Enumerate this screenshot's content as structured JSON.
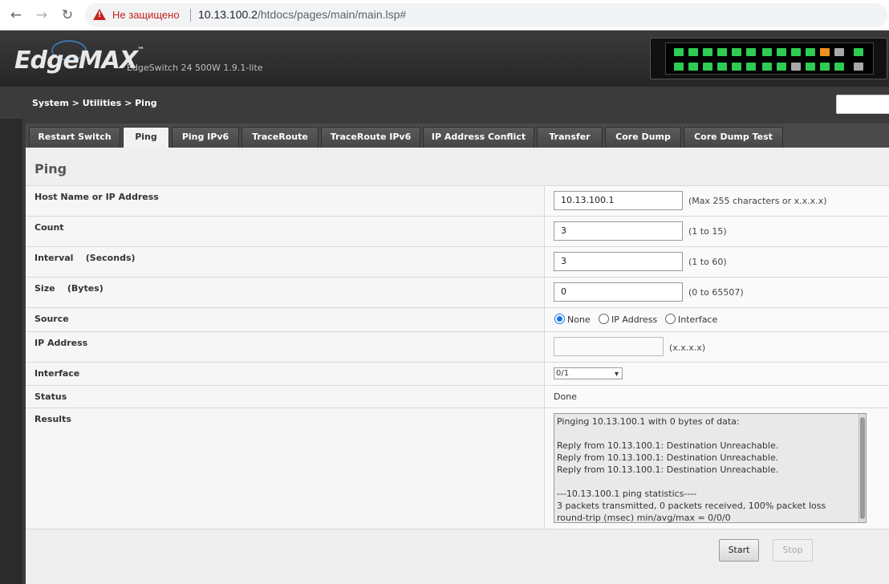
{
  "browser": {
    "insecure_label": "Не защищено",
    "url_host": "10.13.100.2",
    "url_path": "/htdocs/pages/main/main.lsp#"
  },
  "header": {
    "logo": "EdgeMAX",
    "logo_tm": "™",
    "model": "EdgeSwitch 24 500W 1.9.1-lite"
  },
  "breadcrumb": "System > Utilities > Ping",
  "tabs": [
    {
      "label": "Restart Switch"
    },
    {
      "label": "Ping"
    },
    {
      "label": "Ping IPv6"
    },
    {
      "label": "TraceRoute"
    },
    {
      "label": "TraceRoute IPv6"
    },
    {
      "label": "IP Address Conflict"
    },
    {
      "label": "Transfer"
    },
    {
      "label": "Core Dump"
    },
    {
      "label": "Core Dump Test"
    }
  ],
  "active_tab": "Ping",
  "section_title": "Ping",
  "form": {
    "host": {
      "label": "Host Name or IP Address",
      "value": "10.13.100.1",
      "hint": "(Max 255 characters or x.x.x.x)"
    },
    "count": {
      "label": "Count",
      "value": "3",
      "hint": "(1 to 15)"
    },
    "interval": {
      "label": "Interval    (Seconds)",
      "value": "3",
      "hint": "(1 to 60)"
    },
    "size": {
      "label": "Size    (Bytes)",
      "value": "0",
      "hint": "(0 to 65507)"
    },
    "source": {
      "label": "Source",
      "options": [
        "None",
        "IP Address",
        "Interface"
      ],
      "selected": "None"
    },
    "ip_address": {
      "label": "IP Address",
      "value": "",
      "hint": "(x.x.x.x)"
    },
    "interface": {
      "label": "Interface",
      "value": "0/1"
    },
    "status": {
      "label": "Status",
      "value": "Done"
    },
    "results": {
      "label": "Results",
      "text": "Pinging 10.13.100.1 with 0 bytes of data:\n\nReply from 10.13.100.1: Destination Unreachable.\nReply from 10.13.100.1: Destination Unreachable.\nReply from 10.13.100.1: Destination Unreachable.\n\n---10.13.100.1 ping statistics----\n3 packets transmitted, 0 packets received, 100% packet loss\nround-trip (msec) min/avg/max = 0/0/0"
    }
  },
  "buttons": {
    "start": "Start",
    "stop": "Stop"
  },
  "colors": {
    "port_up": "#2ecc52",
    "port_down": "#a8a8a8",
    "port_warn": "#f0901e"
  }
}
